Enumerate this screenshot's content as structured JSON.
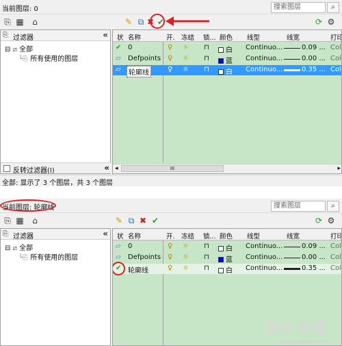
{
  "top": {
    "current_layer": "当前图层: 0",
    "search_placeholder": "搜索图层",
    "filter_header": "过滤器",
    "tree": {
      "root": "全部",
      "child": "所有使用的图层"
    },
    "invert_filter": "反转过滤器(I)",
    "columns": [
      "状",
      "名称",
      "开.",
      "冻结",
      "锁...",
      "颜色",
      "线型",
      "线宽",
      "打印"
    ],
    "rows": [
      {
        "status": "✔",
        "name": "0",
        "color": "白",
        "color_hex": "#ffffff",
        "linetype": "Continuo...",
        "lineweight": "0.09 ...",
        "plot": "Col"
      },
      {
        "status": "▱",
        "name": "Defpoints",
        "color": "蓝",
        "color_hex": "#0000ff",
        "linetype": "Continuo...",
        "lineweight": "0.00 ...",
        "plot": "Col"
      },
      {
        "status": "▱",
        "name": "轮廓线",
        "color": "白",
        "color_hex": "#ffffff",
        "linetype": "Continuo...",
        "lineweight": "0.35 ...",
        "plot": "Col"
      }
    ],
    "hscroll_mark": "III",
    "status_text": "全部: 显示了 3 个图层，共 3 个图层"
  },
  "bottom": {
    "current_layer": "当前图层: 轮廓线",
    "search_placeholder": "搜索图层",
    "filter_header": "过滤器",
    "tree": {
      "root": "全部",
      "child": "所有使用的图层"
    },
    "columns": [
      "状",
      "名称",
      "开.",
      "冻结",
      "锁...",
      "颜色",
      "线型",
      "线宽",
      "打印"
    ],
    "rows": [
      {
        "status": "▱",
        "name": "0",
        "color": "白",
        "color_hex": "#ffffff",
        "linetype": "Continuo...",
        "lineweight": "0.09 ...",
        "plot": "Col"
      },
      {
        "status": "▱",
        "name": "Defpoints",
        "color": "蓝",
        "color_hex": "#0000ff",
        "linetype": "Continuo...",
        "lineweight": "0.00 ...",
        "plot": "Col"
      },
      {
        "status": "✔",
        "name": "轮廓线",
        "color": "白",
        "color_hex": "#ffffff",
        "linetype": "Continuo...",
        "lineweight": "0.35 ...",
        "plot": "Col"
      }
    ]
  },
  "icons": {
    "bulb": "💡",
    "sun": "☼",
    "lock": "🔓",
    "search": "🔍",
    "collapse": "«",
    "new_layer": "✎",
    "new_layer_vp": "⧉",
    "delete": "✖",
    "set_current": "✔",
    "refresh": "⟳",
    "settings": "🔧",
    "filter_new": "⎘",
    "filter_group": "▦",
    "state": "⌂"
  },
  "colors": {
    "accent_red": "#e02020",
    "selection": "#3399ff",
    "grid_bg": "#c7e6c7",
    "delete_red": "#cc2020",
    "check_green": "#2f9e2f"
  },
  "watermark": {
    "text": "Bai 经验",
    "sub": "jingyan.baidu.com"
  }
}
